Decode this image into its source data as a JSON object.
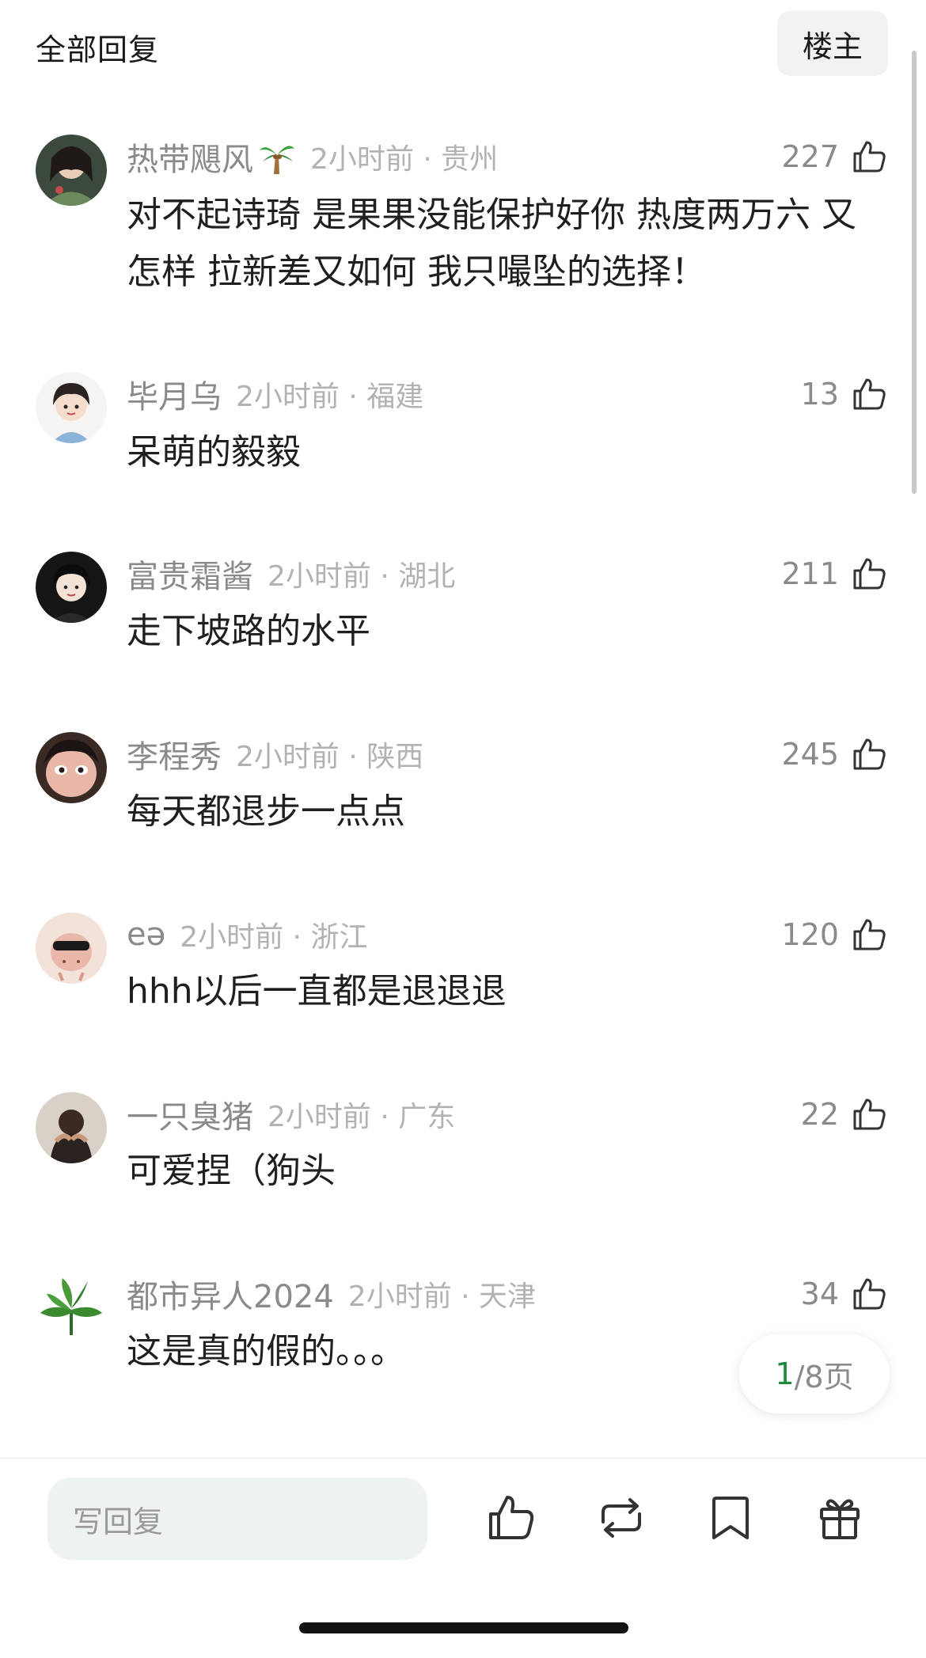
{
  "header": {
    "title": "全部回复",
    "owner_button": "楼主"
  },
  "comments": [
    {
      "username": "热带飓风",
      "emoji": "palm-tree",
      "time_location": "2小时前 · 贵州",
      "likes": "227",
      "text": "对不起诗琦 是果果没能保护好你 热度两万六 又怎样 拉新差又如何 我只嘬坠的选择！"
    },
    {
      "username": "毕月乌",
      "time_location": "2小时前 · 福建",
      "likes": "13",
      "text": "呆萌的毅毅"
    },
    {
      "username": "富贵霜酱",
      "time_location": "2小时前 · 湖北",
      "likes": "211",
      "text": "走下坡路的水平"
    },
    {
      "username": "李程秀",
      "time_location": "2小时前 · 陕西",
      "likes": "245",
      "text": "每天都退步一点点"
    },
    {
      "username": "eə",
      "time_location": "2小时前 · 浙江",
      "likes": "120",
      "text": "hhh以后一直都是退退退"
    },
    {
      "username": "一只臭猪",
      "time_location": "2小时前 · 广东",
      "likes": "22",
      "text": "可爱捏（狗头"
    },
    {
      "username": "都市异人2024",
      "time_location": "2小时前 · 天津",
      "likes": "34",
      "text": "这是真的假的。。。"
    }
  ],
  "pagination": {
    "current": "1",
    "separator_total": "/8页"
  },
  "bottom_bar": {
    "reply_placeholder": "写回复",
    "icons": [
      "thumbs-up-icon",
      "repost-icon",
      "bookmark-icon",
      "gift-icon"
    ]
  },
  "colors": {
    "accent": "#1f8a3b",
    "meta_gray": "#8a8a8a",
    "input_bg": "#eef3ef"
  }
}
